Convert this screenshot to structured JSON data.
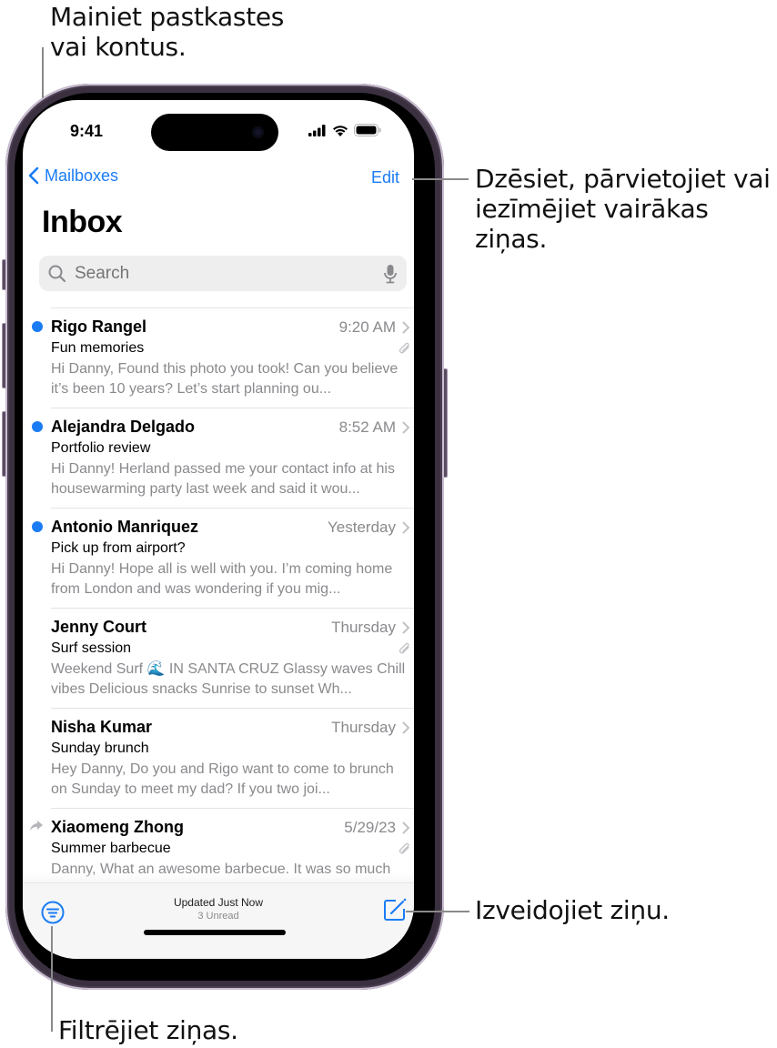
{
  "callouts": {
    "mailboxes": [
      "Mainiet pastkastes",
      "vai kontus."
    ],
    "edit": [
      "Dzēsiet, pārvietojiet vai",
      "iezīmējiet vairākas ziņas."
    ],
    "compose": "Izveidojiet ziņu.",
    "filter": "Filtrējiet ziņas."
  },
  "status_bar": {
    "time": "9:41"
  },
  "nav": {
    "back_label": "Mailboxes",
    "edit_label": "Edit"
  },
  "title": "Inbox",
  "search": {
    "placeholder": "Search"
  },
  "accent_color": "#1a7cf5",
  "messages": [
    {
      "sender": "Rigo Rangel",
      "date": "9:20 AM",
      "subject": "Fun memories",
      "preview": "Hi Danny, Found this photo you took! Can you believe it’s been 10 years? Let’s start planning ou...",
      "unread": true,
      "attachment": true,
      "replied": false
    },
    {
      "sender": "Alejandra Delgado",
      "date": "8:52 AM",
      "subject": "Portfolio review",
      "preview": "Hi Danny! Herland passed me your contact info at his housewarming party last week and said it wou...",
      "unread": true,
      "attachment": false,
      "replied": false
    },
    {
      "sender": "Antonio Manriquez",
      "date": "Yesterday",
      "subject": "Pick up from airport?",
      "preview": "Hi Danny! Hope all is well with you. I’m coming home from London and was wondering if you mig...",
      "unread": true,
      "attachment": false,
      "replied": false
    },
    {
      "sender": "Jenny Court",
      "date": "Thursday",
      "subject": "Surf session",
      "preview": "Weekend Surf 🌊 IN SANTA CRUZ Glassy waves Chill vibes Delicious snacks Sunrise to sunset Wh...",
      "unread": false,
      "attachment": true,
      "replied": false
    },
    {
      "sender": "Nisha Kumar",
      "date": "Thursday",
      "subject": "Sunday brunch",
      "preview": "Hey Danny, Do you and Rigo want to come to brunch on Sunday to meet my dad? If you two joi...",
      "unread": false,
      "attachment": false,
      "replied": false
    },
    {
      "sender": "Xiaomeng Zhong",
      "date": "5/29/23",
      "subject": "Summer barbecue",
      "preview": "Danny, What an awesome barbecue. It was so much fun that I only remembered to take one pict...",
      "unread": false,
      "attachment": true,
      "replied": true
    }
  ],
  "toolbar": {
    "updated": "Updated Just Now",
    "unread_count": "3 Unread"
  }
}
